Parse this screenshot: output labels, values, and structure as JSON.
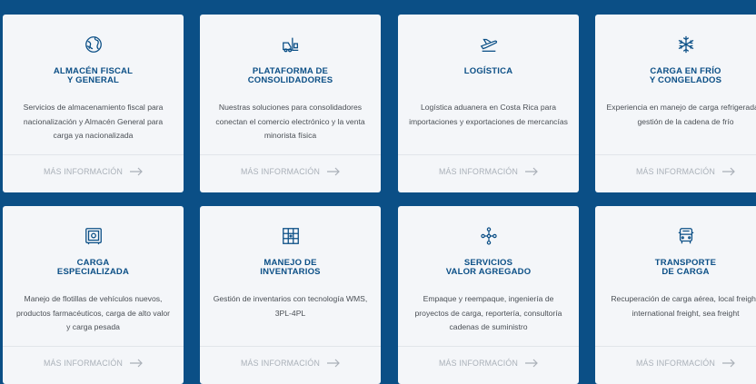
{
  "colors": {
    "background": "#0b4f86",
    "card": "#f4f6f9",
    "title": "#0b4f86",
    "text": "#4a4f55",
    "more": "#a9b0b8"
  },
  "more_label": "MÁS INFORMACIÓN",
  "cards": [
    {
      "icon": "globe-icon",
      "title": "ALMACÉN FISCAL\nY GENERAL",
      "desc": "Servicios de almacenamiento fiscal para nacionalización y Almacén General para carga ya nacionalizada"
    },
    {
      "icon": "forklift-icon",
      "title": "PLATAFORMA DE\nCONSOLIDADORES",
      "desc": "Nuestras soluciones para consolidadores conectan el comercio electrónico y la venta minorista física"
    },
    {
      "icon": "airplane-icon",
      "title": "LOGÍSTICA",
      "desc": "Logística aduanera en Costa Rica para importaciones y exportaciones de mercancías"
    },
    {
      "icon": "snowflake-icon",
      "title": "CARGA EN FRÍO\nY CONGELADOS",
      "desc": "Experiencia en manejo de carga refrigerada y gestión de la cadena de frío"
    },
    {
      "icon": "safe-icon",
      "title": "CARGA\nESPECIALIZADA",
      "desc": "Manejo de flotillas de vehículos nuevos, productos farmacéuticos, carga de alto valor y carga pesada"
    },
    {
      "icon": "warehouse-grid-icon",
      "title": "MANEJO DE\nINVENTARIOS",
      "desc": "Gestión de inventarios con tecnología WMS, 3PL-4PL"
    },
    {
      "icon": "network-icon",
      "title": "SERVICIOS\nVALOR AGREGADO",
      "desc": "Empaque y reempaque, ingeniería de proyectos de carga, reportería, consultoría cadenas de suministro"
    },
    {
      "icon": "truck-icon",
      "title": "TRANSPORTE\nDE CARGA",
      "desc": "Recuperación de carga aérea, local freight, international freight, sea freight"
    }
  ]
}
